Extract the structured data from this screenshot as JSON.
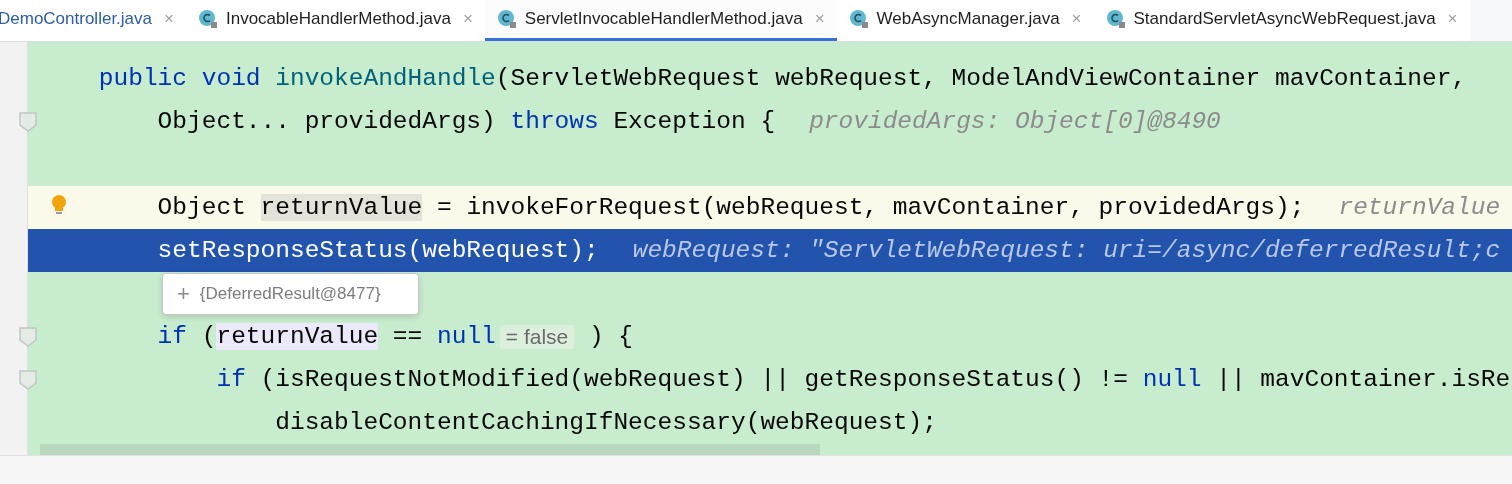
{
  "tabs": [
    {
      "label": "DemoController.java",
      "selected": false,
      "modified": true,
      "icon": false,
      "close": "×"
    },
    {
      "label": "InvocableHandlerMethod.java",
      "selected": false,
      "modified": false,
      "icon": true,
      "close": "×"
    },
    {
      "label": "ServletInvocableHandlerMethod.java",
      "selected": true,
      "modified": false,
      "icon": true,
      "close": "×"
    },
    {
      "label": "WebAsyncManager.java",
      "selected": false,
      "modified": false,
      "icon": true,
      "close": "×"
    },
    {
      "label": "StandardServletAsyncWebRequest.java",
      "selected": false,
      "modified": false,
      "icon": true,
      "close": "×"
    }
  ],
  "editor": {
    "lines": [
      {
        "kind": "code",
        "fold": false,
        "bulb": false,
        "current": false,
        "selected": false,
        "tokens": [
          {
            "kind": "keyword",
            "text": "    public void "
          },
          {
            "kind": "method",
            "text": "invokeAndHandle"
          },
          {
            "kind": "plain",
            "text": "(ServletWebRequest webRequest, ModelAndViewContainer mavContainer,"
          }
        ]
      },
      {
        "kind": "code",
        "fold": true,
        "bulb": false,
        "current": false,
        "selected": false,
        "tokens": [
          {
            "kind": "plain",
            "text": "        Object... providedArgs) "
          },
          {
            "kind": "keyword",
            "text": "throws "
          },
          {
            "kind": "plain",
            "text": "Exception {"
          },
          {
            "kind": "hint",
            "text": "providedArgs: Object[0]@8490"
          }
        ]
      },
      {
        "kind": "blank",
        "fold": false,
        "bulb": false,
        "current": false,
        "selected": false
      },
      {
        "kind": "code",
        "fold": false,
        "bulb": true,
        "current": true,
        "selected": false,
        "tokens": [
          {
            "kind": "plain",
            "text": "        Object "
          },
          {
            "kind": "usage-write",
            "text": "returnValue"
          },
          {
            "kind": "plain",
            "text": " = invokeForRequest(webRequest, mavContainer, providedArgs);"
          },
          {
            "kind": "hint",
            "text": "returnValue"
          }
        ]
      },
      {
        "kind": "code",
        "fold": false,
        "bulb": false,
        "current": false,
        "selected": true,
        "tokens": [
          {
            "kind": "plain",
            "text": "        setResponseStatus(webRequest);"
          },
          {
            "kind": "hint",
            "text": "webRequest: \"ServletWebRequest: uri=/async/deferredResult;c"
          }
        ]
      },
      {
        "kind": "blank",
        "fold": false,
        "bulb": false,
        "current": false,
        "selected": false
      },
      {
        "kind": "code",
        "fold": true,
        "bulb": false,
        "current": false,
        "selected": false,
        "tokens": [
          {
            "kind": "keyword",
            "text": "        if "
          },
          {
            "kind": "plain",
            "text": "("
          },
          {
            "kind": "usage-read",
            "text": "returnValue"
          },
          {
            "kind": "plain",
            "text": " == "
          },
          {
            "kind": "keyword",
            "text": "null"
          },
          {
            "kind": "inline-value",
            "text": "= false"
          },
          {
            "kind": "plain",
            "text": " ) {"
          }
        ]
      },
      {
        "kind": "code",
        "fold": true,
        "bulb": false,
        "current": false,
        "selected": false,
        "tokens": [
          {
            "kind": "keyword",
            "text": "            if "
          },
          {
            "kind": "plain",
            "text": "(isRequestNotModified(webRequest) || getResponseStatus() != "
          },
          {
            "kind": "keyword",
            "text": "null"
          },
          {
            "kind": "plain",
            "text": " || mavContainer.isRe"
          }
        ]
      },
      {
        "kind": "code",
        "fold": false,
        "bulb": false,
        "current": false,
        "selected": false,
        "tokens": [
          {
            "kind": "plain",
            "text": "                disableContentCachingIfNecessary(webRequest);"
          }
        ]
      }
    ],
    "tooltip": {
      "expand": "+",
      "text": "{DeferredResult@8477}"
    }
  }
}
